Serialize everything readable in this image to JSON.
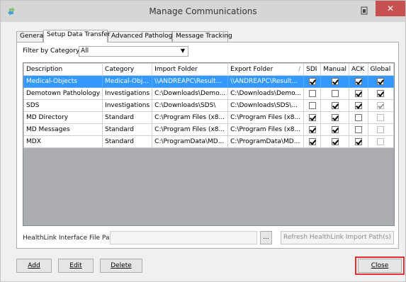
{
  "window": {
    "title": "Manage Communications",
    "icon": "arrows-icon"
  },
  "tabs": [
    {
      "label": "General"
    },
    {
      "label": "Setup Data Transfer",
      "active": true
    },
    {
      "label": "Advanced Pathology"
    },
    {
      "label": "Message Tracking"
    }
  ],
  "filter": {
    "label": "Filter by Category",
    "value": "All"
  },
  "table": {
    "columns": [
      "Description",
      "Category",
      "Import Folder",
      "Export Folder",
      "SDI",
      "Manual",
      "ACK",
      "Global"
    ],
    "rows": [
      {
        "description": "Medical-Objects",
        "category": "Medical-Obj...",
        "import": "\\\\ANDREAPC\\Result...",
        "export": "\\\\ANDREAPC\\Result...",
        "sdi": true,
        "manual": true,
        "ack": true,
        "global": true,
        "global_disabled": false,
        "selected": true
      },
      {
        "description": "Demotown Patholology",
        "category": "Investigations",
        "import": "C:\\Downloads\\Demo...",
        "export": "C:\\Downloads\\Demo...",
        "sdi": false,
        "manual": false,
        "ack": true,
        "global": true,
        "global_disabled": false,
        "selected": false
      },
      {
        "description": "SDS",
        "category": "Investigations",
        "import": "C:\\Downloads\\SDS\\",
        "export": "C:\\Downloads\\SDS\\...",
        "sdi": false,
        "manual": true,
        "ack": true,
        "global": true,
        "global_disabled": true,
        "selected": false
      },
      {
        "description": "MD Directory",
        "category": "Standard",
        "import": "C:\\Program Files (x8...",
        "export": "C:\\Program Files (x8...",
        "sdi": true,
        "manual": true,
        "ack": false,
        "global": false,
        "global_disabled": true,
        "selected": false
      },
      {
        "description": "MD Messages",
        "category": "Standard",
        "import": "C:\\Program Files (x8...",
        "export": "C:\\Program Files (x8...",
        "sdi": true,
        "manual": true,
        "ack": false,
        "global": false,
        "global_disabled": true,
        "selected": false
      },
      {
        "description": "MDX",
        "category": "Standard",
        "import": "C:\\ProgramData\\MD...",
        "export": "C:\\ProgramData\\MD...",
        "sdi": true,
        "manual": true,
        "ack": true,
        "global": false,
        "global_disabled": true,
        "selected": false
      }
    ],
    "sort_indicator": "/"
  },
  "healthlink": {
    "label": "HealthLink Interface File Path",
    "value": "",
    "browse_label": "...",
    "refresh_label": "Refresh HealthLink Import Path(s)"
  },
  "buttons": {
    "add": "Add",
    "edit": "Edit",
    "delete": "Delete",
    "close": "Close"
  },
  "colors": {
    "selection": "#3399ff",
    "close_highlight": "#e03030",
    "titlebar": "#d6d6d6"
  }
}
